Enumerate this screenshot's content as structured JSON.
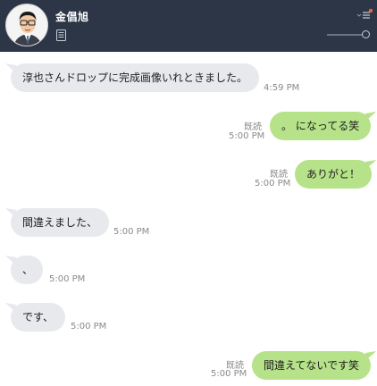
{
  "header": {
    "contact_name": "金倡旭"
  },
  "messages": [
    {
      "side": "in",
      "text": "淳也さんドロップに完成画像いれときました。",
      "time": "4:59 PM"
    },
    {
      "side": "out",
      "text": "。 になってる笑",
      "time": "5:00 PM",
      "read": "既読"
    },
    {
      "side": "out",
      "text": "ありがと！",
      "time": "5:00 PM",
      "read": "既読"
    },
    {
      "side": "in",
      "text": "間違えました、",
      "time": "5:00 PM"
    },
    {
      "side": "in",
      "text": "、",
      "time": "5:00 PM"
    },
    {
      "side": "in",
      "text": "です、",
      "time": "5:00 PM"
    },
    {
      "side": "out",
      "text": "間違えてないです笑",
      "time": "5:00 PM",
      "read": "既読"
    }
  ],
  "colors": {
    "header_bg": "#2c3646",
    "incoming_bubble": "#e8e9ed",
    "outgoing_bubble": "#b6e28a",
    "notification_dot": "#e8663c"
  },
  "icons": [
    "avatar",
    "notes-icon",
    "menu-icon",
    "notification-dot"
  ]
}
